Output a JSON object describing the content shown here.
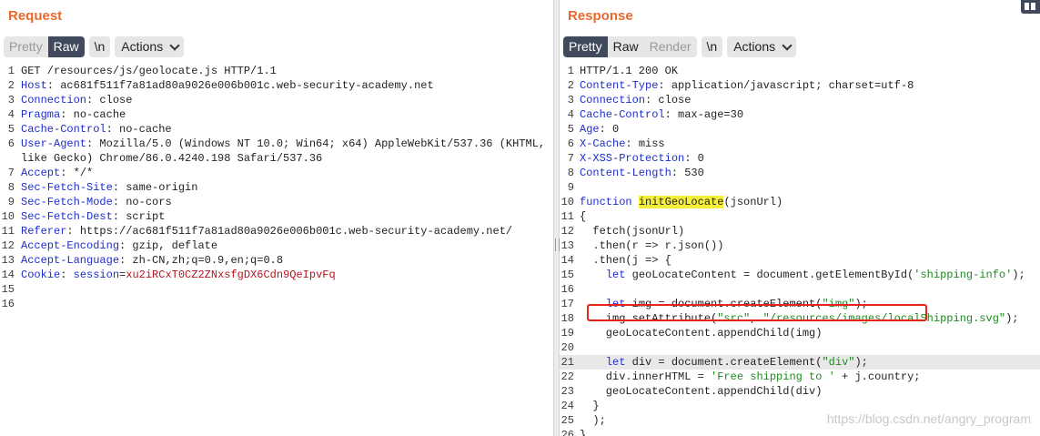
{
  "request": {
    "title": "Request",
    "tabs": [
      "Pretty",
      "Raw",
      "\\n"
    ],
    "actions_label": "Actions",
    "lines": [
      {
        "n": "1",
        "parts": [
          [
            "",
            "GET /resources/js/geolocate.js HTTP/1.1"
          ]
        ]
      },
      {
        "n": "2",
        "parts": [
          [
            "hk",
            "Host"
          ],
          [
            "",
            ": ac681f511f7a81ad80a9026e006b001c.web-security-academy.net"
          ]
        ]
      },
      {
        "n": "3",
        "parts": [
          [
            "hk",
            "Connection"
          ],
          [
            "",
            ": close"
          ]
        ]
      },
      {
        "n": "4",
        "parts": [
          [
            "hk",
            "Pragma"
          ],
          [
            "",
            ": no-cache"
          ]
        ]
      },
      {
        "n": "5",
        "parts": [
          [
            "hk",
            "Cache-Control"
          ],
          [
            "",
            ": no-cache"
          ]
        ]
      },
      {
        "n": "6",
        "parts": [
          [
            "hk",
            "User-Agent"
          ],
          [
            "",
            ": Mozilla/5.0 (Windows NT 10.0; Win64; x64) AppleWebKit/537.36 (KHTML,"
          ]
        ]
      },
      {
        "n": "",
        "parts": [
          [
            "",
            "like Gecko) Chrome/86.0.4240.198 Safari/537.36"
          ]
        ]
      },
      {
        "n": "7",
        "parts": [
          [
            "hk",
            "Accept"
          ],
          [
            "",
            ": */*"
          ]
        ]
      },
      {
        "n": "8",
        "parts": [
          [
            "hk",
            "Sec-Fetch-Site"
          ],
          [
            "",
            ": same-origin"
          ]
        ]
      },
      {
        "n": "9",
        "parts": [
          [
            "hk",
            "Sec-Fetch-Mode"
          ],
          [
            "",
            ": no-cors"
          ]
        ]
      },
      {
        "n": "10",
        "parts": [
          [
            "hk",
            "Sec-Fetch-Dest"
          ],
          [
            "",
            ": script"
          ]
        ]
      },
      {
        "n": "11",
        "parts": [
          [
            "hk",
            "Referer"
          ],
          [
            "",
            ": https://ac681f511f7a81ad80a9026e006b001c.web-security-academy.net/"
          ]
        ]
      },
      {
        "n": "12",
        "parts": [
          [
            "hk",
            "Accept-Encoding"
          ],
          [
            "",
            ": gzip, deflate"
          ]
        ]
      },
      {
        "n": "13",
        "parts": [
          [
            "hk",
            "Accept-Language"
          ],
          [
            "",
            ": zh-CN,zh;q=0.9,en;q=0.8"
          ]
        ]
      },
      {
        "n": "14",
        "parts": [
          [
            "hk",
            "Cookie"
          ],
          [
            "",
            ": "
          ],
          [
            "hk",
            "session"
          ],
          [
            "",
            "="
          ],
          [
            "ck",
            "xu2iRCxT0CZ2ZNxsfgDX6Cdn9QeIpvFq"
          ]
        ]
      },
      {
        "n": "15",
        "parts": []
      },
      {
        "n": "16",
        "parts": []
      }
    ]
  },
  "response": {
    "title": "Response",
    "tabs": [
      "Pretty",
      "Raw",
      "Render",
      "\\n"
    ],
    "actions_label": "Actions",
    "lines": [
      {
        "n": "1",
        "parts": [
          [
            "",
            "HTTP/1.1 200 OK"
          ]
        ]
      },
      {
        "n": "2",
        "parts": [
          [
            "hk",
            "Content-Type"
          ],
          [
            "",
            ": application/javascript; charset=utf-8"
          ]
        ]
      },
      {
        "n": "3",
        "parts": [
          [
            "hk",
            "Connection"
          ],
          [
            "",
            ": close"
          ]
        ]
      },
      {
        "n": "4",
        "parts": [
          [
            "hk",
            "Cache-Control"
          ],
          [
            "",
            ": max-age=30"
          ]
        ]
      },
      {
        "n": "5",
        "parts": [
          [
            "hk",
            "Age"
          ],
          [
            "",
            ": 0"
          ]
        ]
      },
      {
        "n": "6",
        "parts": [
          [
            "hk",
            "X-Cache"
          ],
          [
            "",
            ": miss"
          ]
        ]
      },
      {
        "n": "7",
        "parts": [
          [
            "hk",
            "X-XSS-Protection"
          ],
          [
            "",
            ": 0"
          ]
        ]
      },
      {
        "n": "8",
        "parts": [
          [
            "hk",
            "Content-Length"
          ],
          [
            "",
            ": 530"
          ]
        ]
      },
      {
        "n": "9",
        "parts": []
      },
      {
        "n": "10",
        "parts": [
          [
            "kw",
            "function"
          ],
          [
            "",
            " "
          ],
          [
            "hl",
            "initGeoLocate"
          ],
          [
            "",
            "(jsonUrl)"
          ]
        ]
      },
      {
        "n": "11",
        "parts": [
          [
            "",
            "{"
          ]
        ]
      },
      {
        "n": "12",
        "parts": [
          [
            "",
            "  fetch(jsonUrl)"
          ]
        ]
      },
      {
        "n": "13",
        "parts": [
          [
            "",
            "  .then(r => r.json())"
          ]
        ]
      },
      {
        "n": "14",
        "parts": [
          [
            "",
            "  .then(j => {"
          ]
        ]
      },
      {
        "n": "15",
        "parts": [
          [
            "",
            "    "
          ],
          [
            "kw",
            "let"
          ],
          [
            "",
            " geoLocateContent = document.getElementById("
          ],
          [
            "str",
            "'shipping-info'"
          ],
          [
            "",
            ");"
          ]
        ]
      },
      {
        "n": "16",
        "parts": []
      },
      {
        "n": "17",
        "parts": [
          [
            "",
            "    "
          ],
          [
            "kw",
            "let"
          ],
          [
            "",
            " img = document.createElement("
          ],
          [
            "str",
            "\"img\""
          ],
          [
            "",
            ");"
          ]
        ]
      },
      {
        "n": "18",
        "parts": [
          [
            "",
            "    img.setAttribute("
          ],
          [
            "str",
            "\"src\""
          ],
          [
            "",
            ", "
          ],
          [
            "str",
            "\"/resources/images/localShipping.svg\""
          ],
          [
            "",
            ");"
          ]
        ]
      },
      {
        "n": "19",
        "parts": [
          [
            "",
            "    geoLocateContent.appendChild(img)"
          ]
        ]
      },
      {
        "n": "20",
        "parts": []
      },
      {
        "n": "21",
        "cur": true,
        "parts": [
          [
            "",
            "    "
          ],
          [
            "kw",
            "let"
          ],
          [
            "",
            " div = document.createElement("
          ],
          [
            "str",
            "\"div\""
          ],
          [
            "",
            ");"
          ]
        ]
      },
      {
        "n": "22",
        "parts": [
          [
            "",
            "    div.innerHTML = "
          ],
          [
            "str",
            "'Free shipping to '"
          ],
          [
            "",
            " + j.country;"
          ]
        ]
      },
      {
        "n": "23",
        "parts": [
          [
            "",
            "    geoLocateContent.appendChild(div)"
          ]
        ]
      },
      {
        "n": "24",
        "parts": [
          [
            "",
            "  }"
          ]
        ]
      },
      {
        "n": "25",
        "parts": [
          [
            "",
            "  );"
          ]
        ]
      },
      {
        "n": "26",
        "parts": [
          [
            "",
            "}"
          ]
        ]
      }
    ]
  },
  "watermark": "https://blog.csdn.net/angry_program",
  "colors": {
    "title": "#e8692b",
    "active_tab": "#404a5c",
    "header_key": "#1f2dcc",
    "cookie_value": "#b9121f",
    "string": "#1e8a1e",
    "highlight": "#f5ef3b",
    "annotation_box": "#e8241a"
  }
}
